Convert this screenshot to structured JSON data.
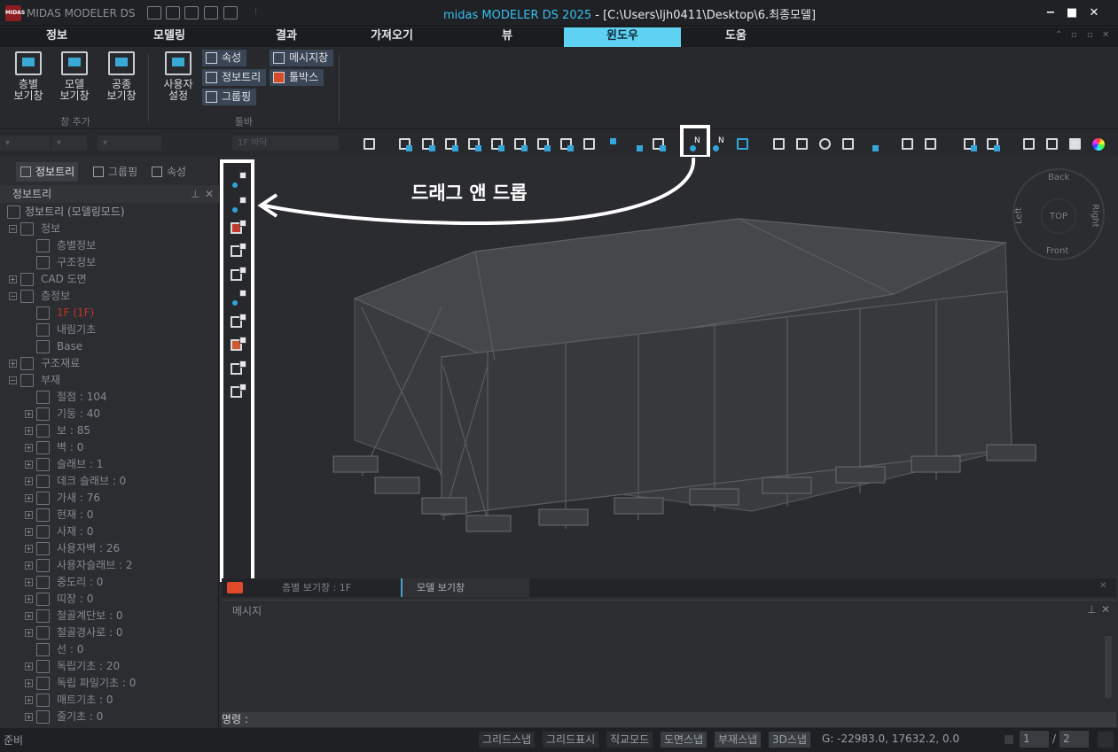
{
  "app": {
    "logo": "MIDAS",
    "name": "MIDAS MODELER DS",
    "title_product": "midas MODELER DS 2025",
    "title_path": " - [C:\\Users\\ljh0411\\Desktop\\6.최종모델]",
    "window_controls": [
      "−",
      "■",
      "✕"
    ]
  },
  "menu": {
    "tabs": [
      "정보",
      "모델링",
      "결과",
      "가져오기",
      "뷰",
      "윈도우",
      "도움"
    ],
    "active": "윈도우",
    "right_controls": [
      "⌃",
      "▫",
      "▫",
      "✕"
    ]
  },
  "ribbon": {
    "groups": [
      {
        "label": "창 추가",
        "buttons": [
          {
            "label1": "층별",
            "label2": "보기창",
            "icon": "floor-view-icon"
          },
          {
            "label1": "모델",
            "label2": "보기창",
            "icon": "model-view-icon"
          },
          {
            "label1": "공종",
            "label2": "보기창",
            "icon": "trade-view-icon"
          }
        ]
      },
      {
        "label": "툴바",
        "big_button": {
          "label1": "사용자",
          "label2": "설정",
          "icon": "user-settings-icon"
        },
        "small_buttons": [
          "속성",
          "정보트리",
          "그룹핑",
          "메시지창",
          "툴박스"
        ]
      }
    ]
  },
  "toolbar": {
    "combo_floor": "1F 바닥",
    "highlighted_tool": "node-tool"
  },
  "left_panel": {
    "tabs": [
      "정보트리",
      "그룹핑",
      "속성"
    ],
    "header": "정보트리",
    "tree": [
      {
        "label": "정보트리 (모델링모드)",
        "level": 0,
        "root": true
      },
      {
        "label": "정보",
        "level": 1,
        "exp": "−"
      },
      {
        "label": "층별정보",
        "level": 2
      },
      {
        "label": "구조정보",
        "level": 2
      },
      {
        "label": "CAD 도면",
        "level": 1,
        "exp": "+"
      },
      {
        "label": "층정보",
        "level": 1,
        "exp": "−"
      },
      {
        "label": "1F (1F)",
        "level": 2,
        "hl": true
      },
      {
        "label": "내림기초",
        "level": 2
      },
      {
        "label": "Base",
        "level": 2
      },
      {
        "label": "구조재료",
        "level": 1,
        "exp": "+"
      },
      {
        "label": "부재",
        "level": 1,
        "exp": "−"
      },
      {
        "label": "절점 : 104",
        "level": 2
      },
      {
        "label": "기둥 : 40",
        "level": 2,
        "exp": "+"
      },
      {
        "label": "보 : 85",
        "level": 2,
        "exp": "+"
      },
      {
        "label": "벽 : 0",
        "level": 2,
        "exp": "+"
      },
      {
        "label": "슬래브 : 1",
        "level": 2,
        "exp": "+"
      },
      {
        "label": "데크 슬래브 : 0",
        "level": 2,
        "exp": "+"
      },
      {
        "label": "가새 : 76",
        "level": 2,
        "exp": "+"
      },
      {
        "label": "현재 : 0",
        "level": 2,
        "exp": "+"
      },
      {
        "label": "사재 : 0",
        "level": 2,
        "exp": "+"
      },
      {
        "label": "사용자벽 : 26",
        "level": 2,
        "exp": "+"
      },
      {
        "label": "사용자슬래브 : 2",
        "level": 2,
        "exp": "+"
      },
      {
        "label": "중도리 : 0",
        "level": 2,
        "exp": "+"
      },
      {
        "label": "띠장 : 0",
        "level": 2,
        "exp": "+"
      },
      {
        "label": "철골계단보 : 0",
        "level": 2,
        "exp": "+"
      },
      {
        "label": "철골경사로 : 0",
        "level": 2,
        "exp": "+"
      },
      {
        "label": "선 : 0",
        "level": 2
      },
      {
        "label": "독립기초 : 20",
        "level": 2,
        "exp": "+"
      },
      {
        "label": "독립 파일기초 : 0",
        "level": 2,
        "exp": "+"
      },
      {
        "label": "매트기초 : 0",
        "level": 2,
        "exp": "+"
      },
      {
        "label": "줄기초 : 0",
        "level": 2,
        "exp": "+"
      }
    ]
  },
  "annotation": {
    "text": "드래그 앤 드롭",
    "color": "#ffffff"
  },
  "viewcube": {
    "top": "TOP",
    "back": "Back",
    "front": "Front",
    "left": "Left",
    "right": "Right"
  },
  "view_tabs": [
    "층별 보기창 : 1F",
    "모델 보기창"
  ],
  "message_panel": {
    "title": "메시지",
    "command_label": "명령 :"
  },
  "status": {
    "left": "준비",
    "snaps": [
      "그리드스냅",
      "그리드표시",
      "직교모드",
      "도면스냅",
      "부재스냅",
      "3D스냅"
    ],
    "snaps_on": [
      "도면스냅",
      "부재스냅",
      "3D스냅"
    ],
    "coords": "G: -22983.0, 17632.2, 0.0",
    "page_current": "1",
    "page_total": "2",
    "page_sep": "/"
  },
  "colors": {
    "accent": "#5fd2f4",
    "selection": "#35a6dd",
    "highlight_text": "#c0352b"
  }
}
